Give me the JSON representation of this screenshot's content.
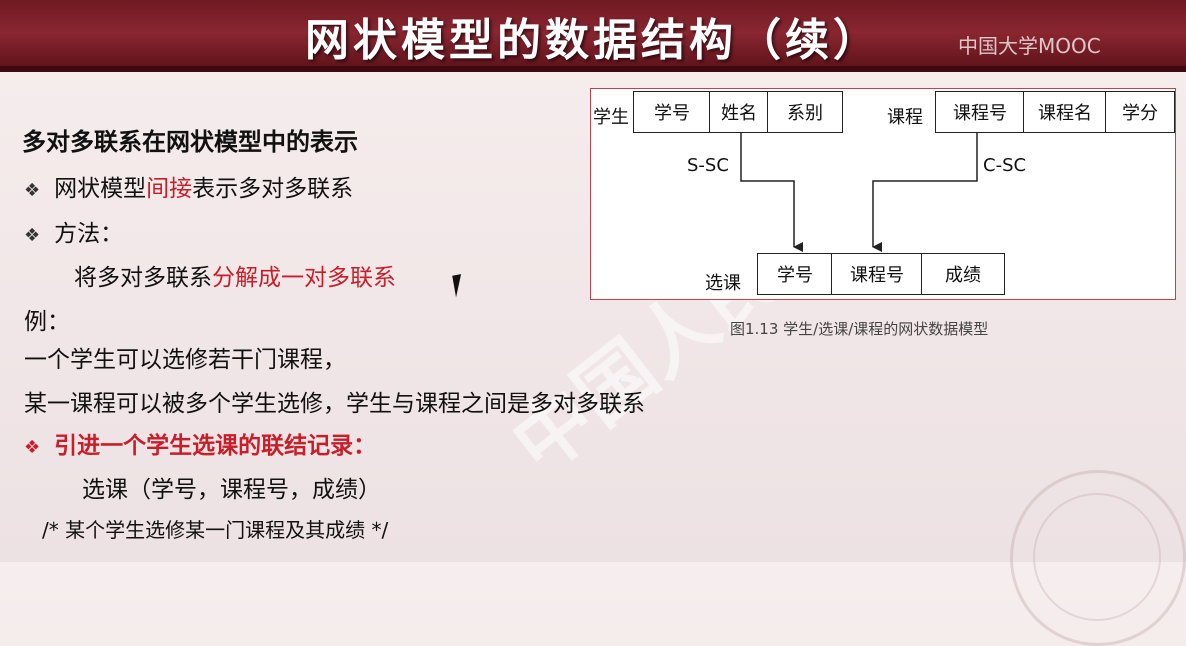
{
  "slide": {
    "title": "网状模型的数据结构（续）",
    "logo": "中国大学MOOC",
    "heading": "多对多联系在网状模型中的表示",
    "bullet1": {
      "pre": "网状模型",
      "red": "间接",
      "post": "表示多对多联系"
    },
    "bullet2": "方法：",
    "method": {
      "pre": "将多对多联系",
      "red": "分解成一对多联系"
    },
    "example_label": "例：",
    "example_line1": "一个学生可以选修若干门课程，",
    "example_line2": "某一课程可以被多个学生选修，学生与课程之间是多对多联系",
    "bullet3": "引进一个学生选课的联结记录：",
    "record": "选课（学号，课程号，成绩）",
    "comment": "/* 某个学生选修某一门课程及其成绩 */",
    "bullet_glyph": "❖"
  },
  "diagram": {
    "student_label": "学生",
    "student_fields": [
      "学号",
      "姓名",
      "系别"
    ],
    "course_label": "课程",
    "course_fields": [
      "课程号",
      "课程名",
      "学分"
    ],
    "sc_label": "选课",
    "sc_fields": [
      "学号",
      "课程号",
      "成绩"
    ],
    "set_s_sc": "S-SC",
    "set_c_sc": "C-SC",
    "caption": "图1.13  学生/选课/课程的网状数据模型"
  },
  "colors": {
    "title_bg": "#7a1d26",
    "accent_red": "#c81e2a"
  }
}
